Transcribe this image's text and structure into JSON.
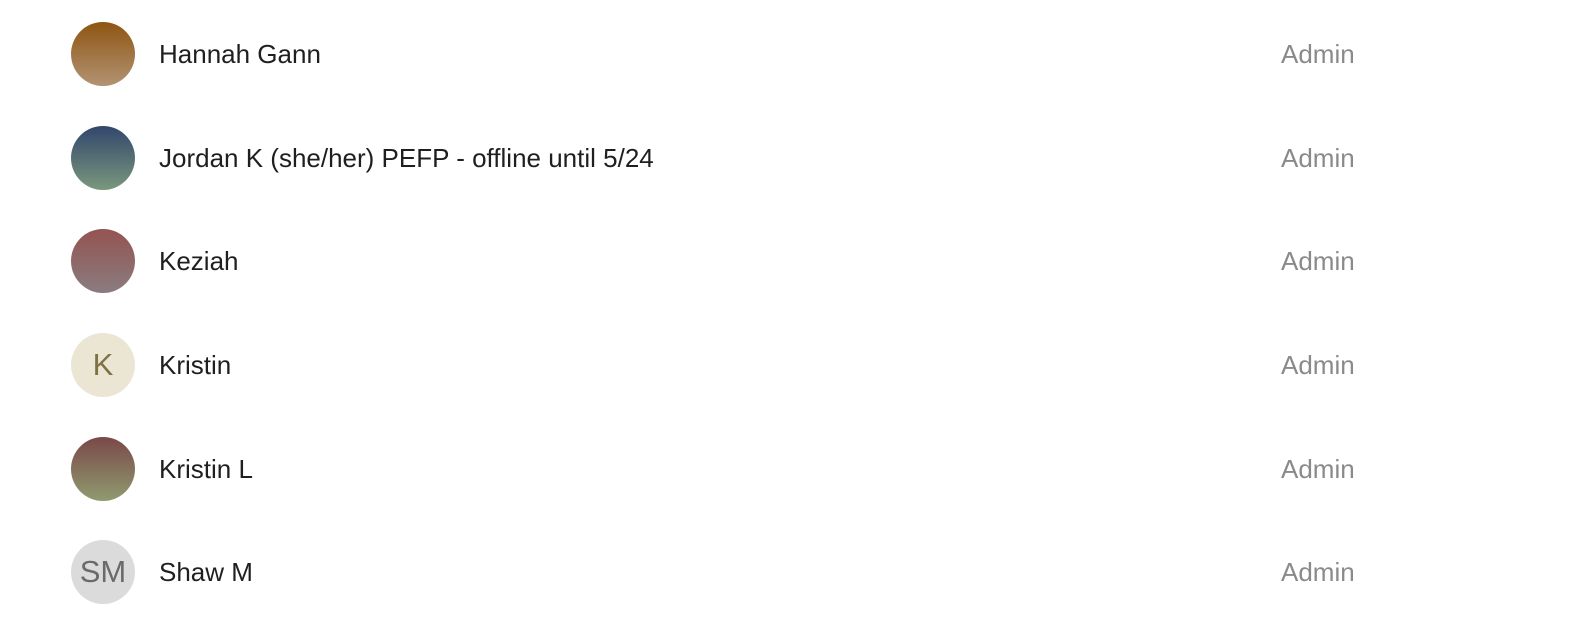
{
  "members": [
    {
      "name": "Hannah Gann",
      "role": "Admin",
      "avatar": {
        "type": "gradient",
        "initials": "",
        "colors": [
          "#8e5511",
          "#b39374"
        ]
      }
    },
    {
      "name": "Jordan K (she/her) PEFP - offline until 5/24",
      "role": "Admin",
      "avatar": {
        "type": "gradient",
        "initials": "",
        "colors": [
          "#33466c",
          "#79987d"
        ]
      }
    },
    {
      "name": "Keziah",
      "role": "Admin",
      "avatar": {
        "type": "gradient",
        "initials": "",
        "colors": [
          "#945351",
          "#8a7c7f"
        ]
      }
    },
    {
      "name": "Kristin",
      "role": "Admin",
      "avatar": {
        "type": "initials",
        "initials": "K",
        "background": "#ebe5d4",
        "text_color": "#7f7345"
      }
    },
    {
      "name": "Kristin L",
      "role": "Admin",
      "avatar": {
        "type": "gradient",
        "initials": "",
        "colors": [
          "#7a4848",
          "#8f9b70"
        ]
      }
    },
    {
      "name": "Shaw M",
      "role": "Admin",
      "avatar": {
        "type": "initials",
        "initials": "SM",
        "background": "#dbdbdb",
        "text_color": "#6a6a6a"
      }
    }
  ]
}
